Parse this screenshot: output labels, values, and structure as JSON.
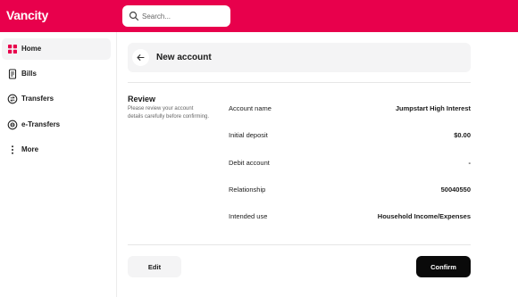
{
  "app": {
    "brand": "Vancity",
    "brand_color": "#e8004c"
  },
  "search": {
    "placeholder": "Search..."
  },
  "sidebar": {
    "items": [
      {
        "label": "Home",
        "icon": "home-grid-icon",
        "active": true
      },
      {
        "label": "Bills",
        "icon": "bill-icon",
        "active": false
      },
      {
        "label": "Transfers",
        "icon": "transfer-icon",
        "active": false
      },
      {
        "label": "e-Transfers",
        "icon": "etransfer-icon",
        "active": false
      },
      {
        "label": "More",
        "icon": "more-vertical-icon",
        "active": false
      }
    ]
  },
  "header": {
    "title": "New account"
  },
  "review": {
    "title": "Review",
    "description": "Please review your account details carefully before confirming.",
    "rows": [
      {
        "label": "Account name",
        "value": "Jumpstart High Interest"
      },
      {
        "label": "Initial deposit",
        "value": "$0.00"
      },
      {
        "label": "Debit account",
        "value": "-"
      },
      {
        "label": "Relationship",
        "value": "50040550"
      },
      {
        "label": "Intended use",
        "value": "Household Income/Expenses"
      }
    ]
  },
  "actions": {
    "edit_label": "Edit",
    "confirm_label": "Confirm"
  }
}
